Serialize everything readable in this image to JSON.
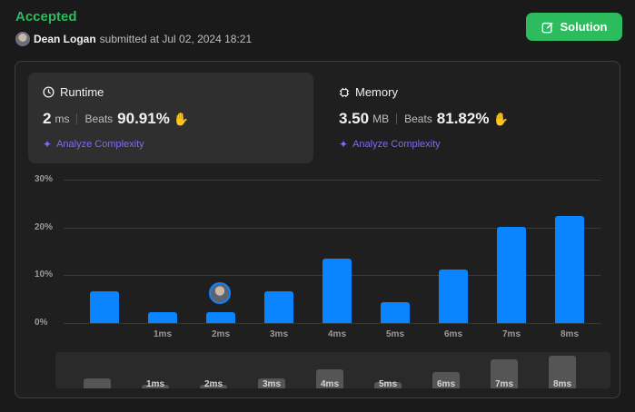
{
  "header": {
    "status": "Accepted",
    "user": "Dean Logan",
    "submitted_text": "submitted at Jul 02, 2024 18:21",
    "solution_button": "Solution"
  },
  "runtime": {
    "title": "Runtime",
    "value": "2",
    "unit": "ms",
    "beats_label": "Beats",
    "beats_pct": "90.91%",
    "analyze": "Analyze Complexity"
  },
  "memory": {
    "title": "Memory",
    "value": "3.50",
    "unit": "MB",
    "beats_label": "Beats",
    "beats_pct": "81.82%",
    "analyze": "Analyze Complexity"
  },
  "colors": {
    "accent": "#2cbb5d",
    "bar": "#0a84ff",
    "link": "#7b6cf0"
  },
  "chart_data": {
    "type": "bar",
    "y_ticks": [
      "30%",
      "20%",
      "10%",
      "0%"
    ],
    "ylim": [
      0,
      30
    ],
    "categories": [
      "",
      "1ms",
      "2ms",
      "3ms",
      "4ms",
      "5ms",
      "6ms",
      "7ms",
      "8ms"
    ],
    "values": [
      6.6,
      2.2,
      2.2,
      6.6,
      13.4,
      4.4,
      11.2,
      20.2,
      22.5
    ],
    "highlighted_category": "2ms",
    "grid": true
  }
}
